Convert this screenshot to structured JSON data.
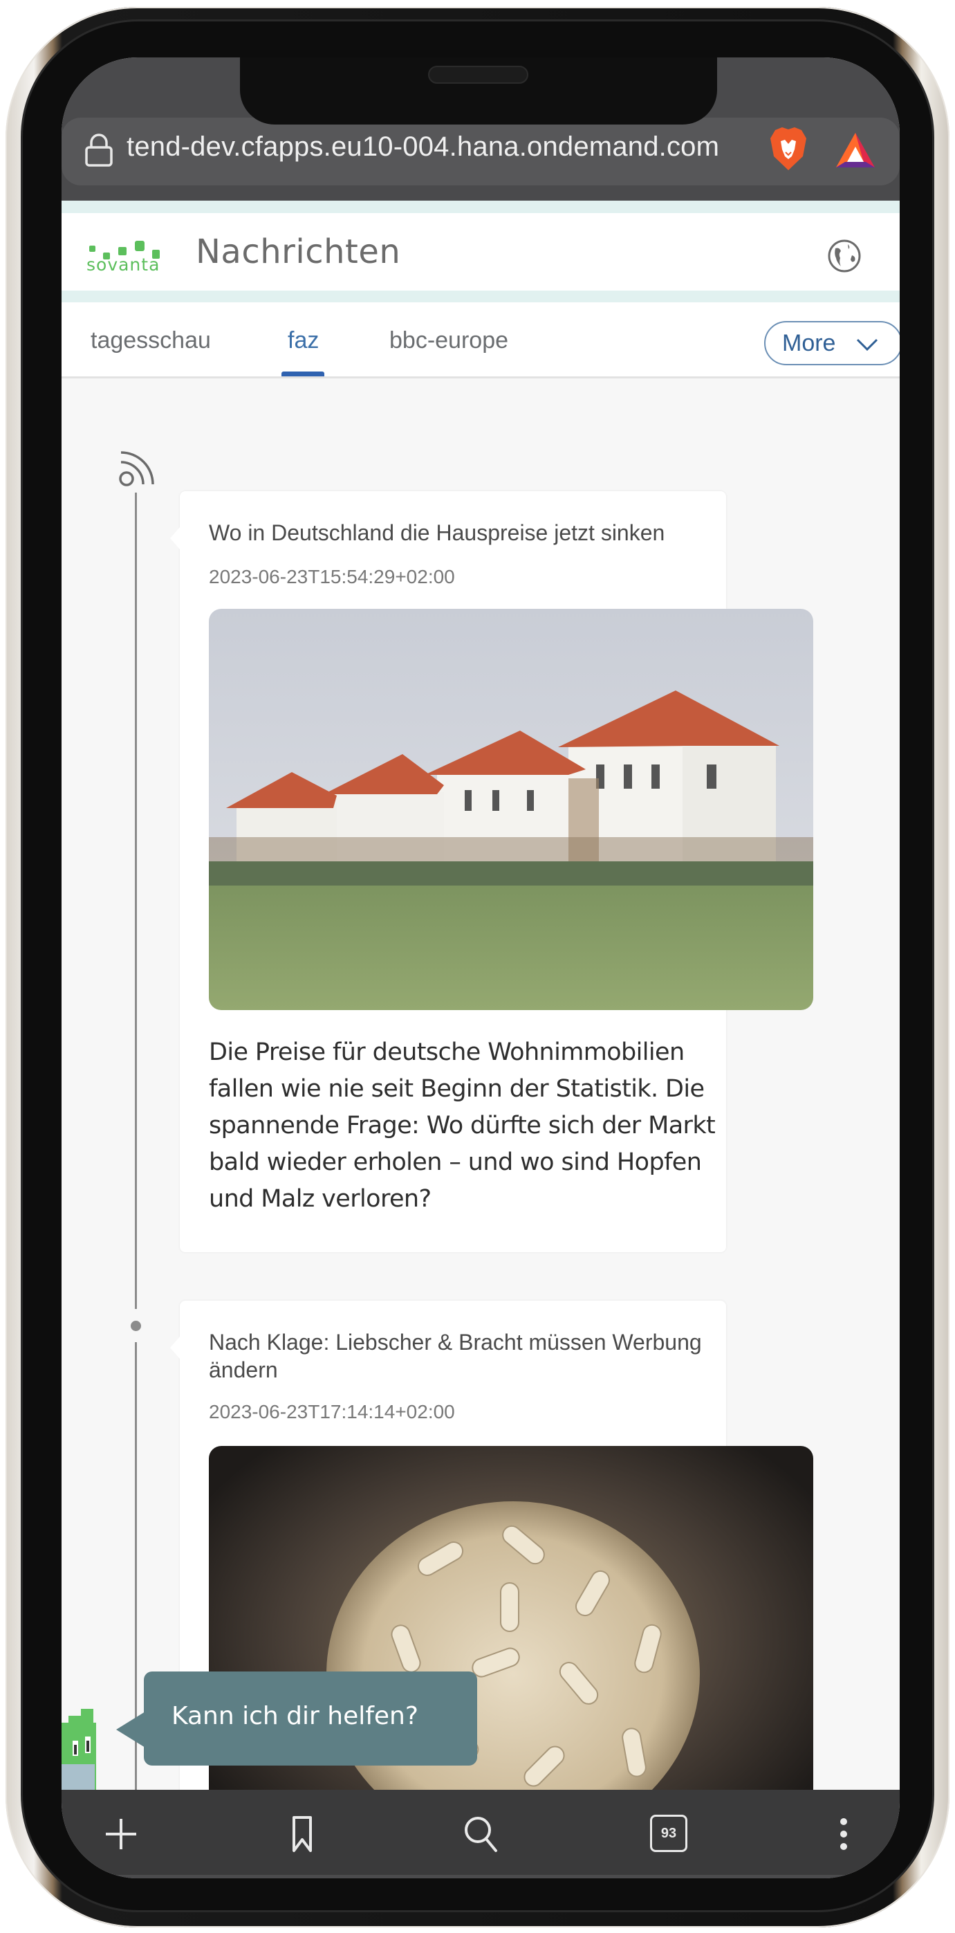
{
  "browser": {
    "url": "tend-dev.cfapps.eu10-004.hana.ondemand.com",
    "icons": [
      "lock-icon",
      "brave-lion-icon",
      "bat-rewards-icon"
    ]
  },
  "app": {
    "logo_text": "sovanta",
    "title": "Nachrichten",
    "globe_icon": "globe-icon",
    "brand_color": "#5cbf5c",
    "accent_color": "#2f62b0"
  },
  "tabs": {
    "items": [
      {
        "label": "tagesschau",
        "active": false
      },
      {
        "label": "faz",
        "active": true
      },
      {
        "label": "bbc-europe",
        "active": false
      }
    ],
    "more_label": "More"
  },
  "feed": {
    "items": [
      {
        "title": "Wo in Deutschland die Hauspreise jetzt sinken",
        "date": "2023-06-23T15:54:29+02:00",
        "image": "row of white terraced houses with red roofs behind a green field",
        "description": "Die Preise für deutsche Wohnimmobilien fallen wie nie seit Beginn der Statistik. Die spannende Frage: Wo dürfte sich der Markt bald wieder erholen – und wo sind Hopfen und Malz verloren?"
      },
      {
        "title": "Nach Klage: Liebscher & Bracht müssen Werbung ändern",
        "date": "2023-06-23T17:14:14+02:00",
        "image": "pile of beige capsules in a metal bowl"
      }
    ]
  },
  "assistant": {
    "message": "Kann ich dir helfen?",
    "bubble_color": "#5e7f85"
  },
  "bottom_bar": {
    "tab_count": "93",
    "icons": [
      "plus-icon",
      "bookmark-icon",
      "search-icon",
      "tab-count-icon",
      "more-vertical-icon"
    ]
  }
}
